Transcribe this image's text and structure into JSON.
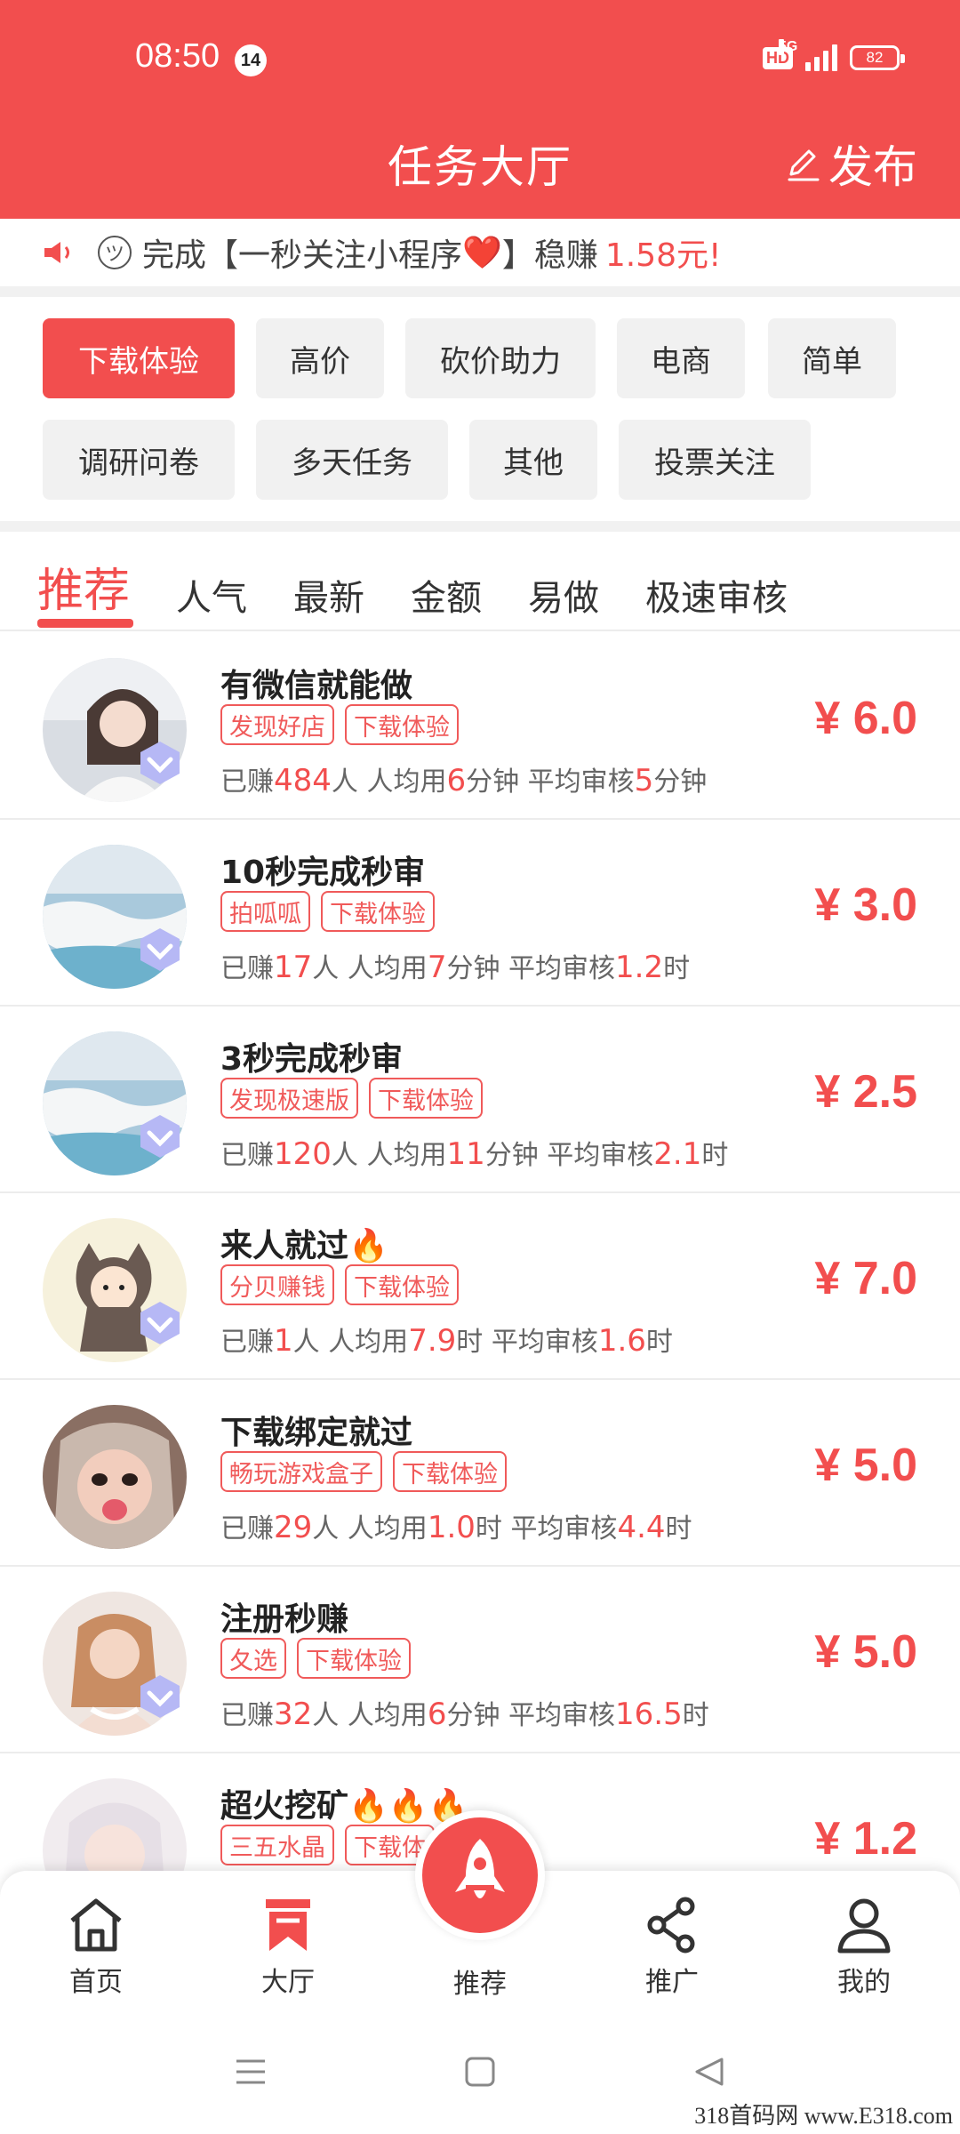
{
  "status_bar": {
    "time": "08:50",
    "notification_count": "14",
    "hd": "HD",
    "network": "5G",
    "battery": "82"
  },
  "header": {
    "title": "任务大厅",
    "publish_label": "发布"
  },
  "notice": {
    "prefix": "完成【一秒关注小程序",
    "heart": "❤️",
    "suffix": "】稳赚",
    "amount": "1.58元!"
  },
  "categories": [
    "下载体验",
    "高价",
    "砍价助力",
    "电商",
    "简单",
    "调研问卷",
    "多天任务",
    "其他",
    "投票关注"
  ],
  "active_category": "下载体验",
  "sort_tabs": [
    "推荐",
    "人气",
    "最新",
    "金额",
    "易做",
    "极速审核"
  ],
  "active_sort": "推荐",
  "stat_labels": {
    "earned": "已赚",
    "people": "人",
    "avg_time": "人均用",
    "avg_review": "平均审核"
  },
  "tasks": [
    {
      "title": "有微信就能做",
      "tags": [
        "发现好店",
        "下载体验"
      ],
      "earned": "484",
      "avg_time": "6",
      "avg_time_unit": "分钟",
      "review_time": "5",
      "review_unit": "分钟",
      "price": "¥ 6.0"
    },
    {
      "title": "10秒完成秒审",
      "tags": [
        "拍呱呱",
        "下载体验"
      ],
      "earned": "17",
      "avg_time": "7",
      "avg_time_unit": "分钟",
      "review_time": "1.2",
      "review_unit": "时",
      "price": "¥ 3.0"
    },
    {
      "title": "3秒完成秒审",
      "tags": [
        "发现极速版",
        "下载体验"
      ],
      "earned": "120",
      "avg_time": "11",
      "avg_time_unit": "分钟",
      "review_time": "2.1",
      "review_unit": "时",
      "price": "¥ 2.5"
    },
    {
      "title": "来人就过",
      "title_emoji": "🔥",
      "tags": [
        "分贝赚钱",
        "下载体验"
      ],
      "earned": "1",
      "avg_time": "7.9",
      "avg_time_unit": "时",
      "review_time": "1.6",
      "review_unit": "时",
      "price": "¥ 7.0"
    },
    {
      "title": "下载绑定就过",
      "tags": [
        "畅玩游戏盒子",
        "下载体验"
      ],
      "earned": "29",
      "avg_time": "1.0",
      "avg_time_unit": "时",
      "review_time": "4.4",
      "review_unit": "时",
      "price": "¥ 5.0"
    },
    {
      "title": "注册秒赚",
      "tags": [
        "夂选",
        "下载体验"
      ],
      "earned": "32",
      "avg_time": "6",
      "avg_time_unit": "分钟",
      "review_time": "16.5",
      "review_unit": "时",
      "price": "¥ 5.0"
    },
    {
      "title": "超火挖矿",
      "title_emoji": "🔥🔥🔥",
      "tags": [
        "三五水晶",
        "下载体"
      ],
      "price": "¥ 1.2"
    }
  ],
  "bottom_nav": {
    "home": "首页",
    "hall": "大厅",
    "recommend": "推荐",
    "promote": "推广",
    "mine": "我的"
  },
  "watermark": "318首码网 www.E318.com",
  "colors": {
    "brand": "#f24e4e",
    "tag": "#f05a5a",
    "separator": "#f1f1f1"
  }
}
